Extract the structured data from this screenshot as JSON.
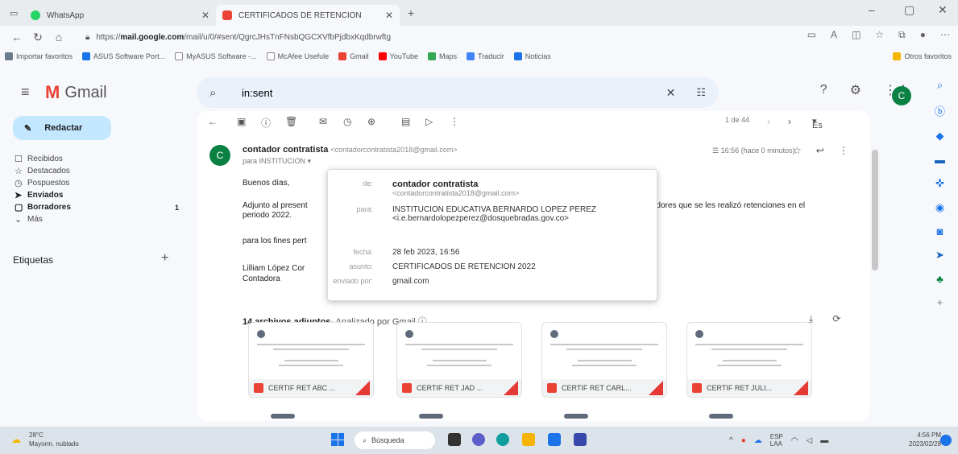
{
  "browser": {
    "tabs": [
      {
        "title": "WhatsApp",
        "color": "#25d366"
      },
      {
        "title": "CERTIFICADOS DE RETENCION",
        "color": "#ea4335"
      }
    ],
    "url_prefix": "https://",
    "url_host": "mail.google.com",
    "url_path": "/mail/u/0/#sent/QgrcJHsTnFNsbQGCXVfbPjdbxKqdbrwftg",
    "bookmarks": [
      "Importar favoritos",
      "ASUS Software Port...",
      "MyASUS Software -...",
      "McAfee Usefule",
      "Gmail",
      "YouTube",
      "Maps",
      "Traducir",
      "Noticias"
    ],
    "other_bookmarks": "Otros favoritos"
  },
  "gmail": {
    "logo_text": "Gmail",
    "search_value": "in:sent",
    "avatar_letter": "C",
    "compose_label": "Redactar",
    "nav": [
      {
        "label": "Recibidos",
        "icon": "☐"
      },
      {
        "label": "Destacados",
        "icon": "☆"
      },
      {
        "label": "Pospuestos",
        "icon": "◷"
      },
      {
        "label": "Enviados",
        "icon": "➤"
      },
      {
        "label": "Borradores",
        "icon": "▢",
        "count": "1"
      },
      {
        "label": "Más",
        "icon": "⌄"
      }
    ],
    "labels_title": "Etiquetas",
    "labels_add": "+"
  },
  "toolbar": {
    "pager": "1 de 44",
    "lang": "Es"
  },
  "email": {
    "sender_letter": "C",
    "sender_name": "contador contratista",
    "sender_email": "<contadorcontratista2018@gmail.com>",
    "to_line": "para INSTITUCION ▾",
    "meta": "16:56 (hace 0 minutos)",
    "greeting": "Buenos días,",
    "line1_start": "Adjunto al present",
    "line1_end": "edores que se les realizó retenciones en el",
    "line2": "periodo 2022.",
    "line3": "para los fines pert",
    "sign_name": "Lilliam López Cor",
    "sign_title": "Contadora",
    "attach_count": "14 archivos adjuntos",
    "attach_sub": "· Analizado por Gmail ⓘ",
    "attachments": [
      "CERTIF RET ABC ...",
      "CERTIF RET JAD ...",
      "CERTIF RET CARL...",
      "CERTIF RET JULI..."
    ]
  },
  "card": {
    "de_key": "de:",
    "de_name": "contador contratista",
    "de_email": "<contadorcontratista2018@gmail.com>",
    "para_key": "para:",
    "para_name": "INSTITUCION EDUCATIVA BERNARDO LOPEZ PEREZ",
    "para_email": "<i.e.bernardolopezperez@dosquebradas.gov.co>",
    "fecha_key": "fecha:",
    "fecha_val": "28 feb 2023, 16:56",
    "asunto_key": "asunto:",
    "asunto_val": "CERTIFICADOS DE RETENCION 2022",
    "enviado_key": "enviado por:",
    "enviado_val": "gmail.com"
  },
  "taskbar": {
    "temp": "28°C",
    "weather": "Mayorm. nublado",
    "search": "Búsqueda",
    "lang_top": "ESP",
    "lang_bottom": "LAA",
    "time": "4:56 PM",
    "date": "2023/02/28"
  }
}
